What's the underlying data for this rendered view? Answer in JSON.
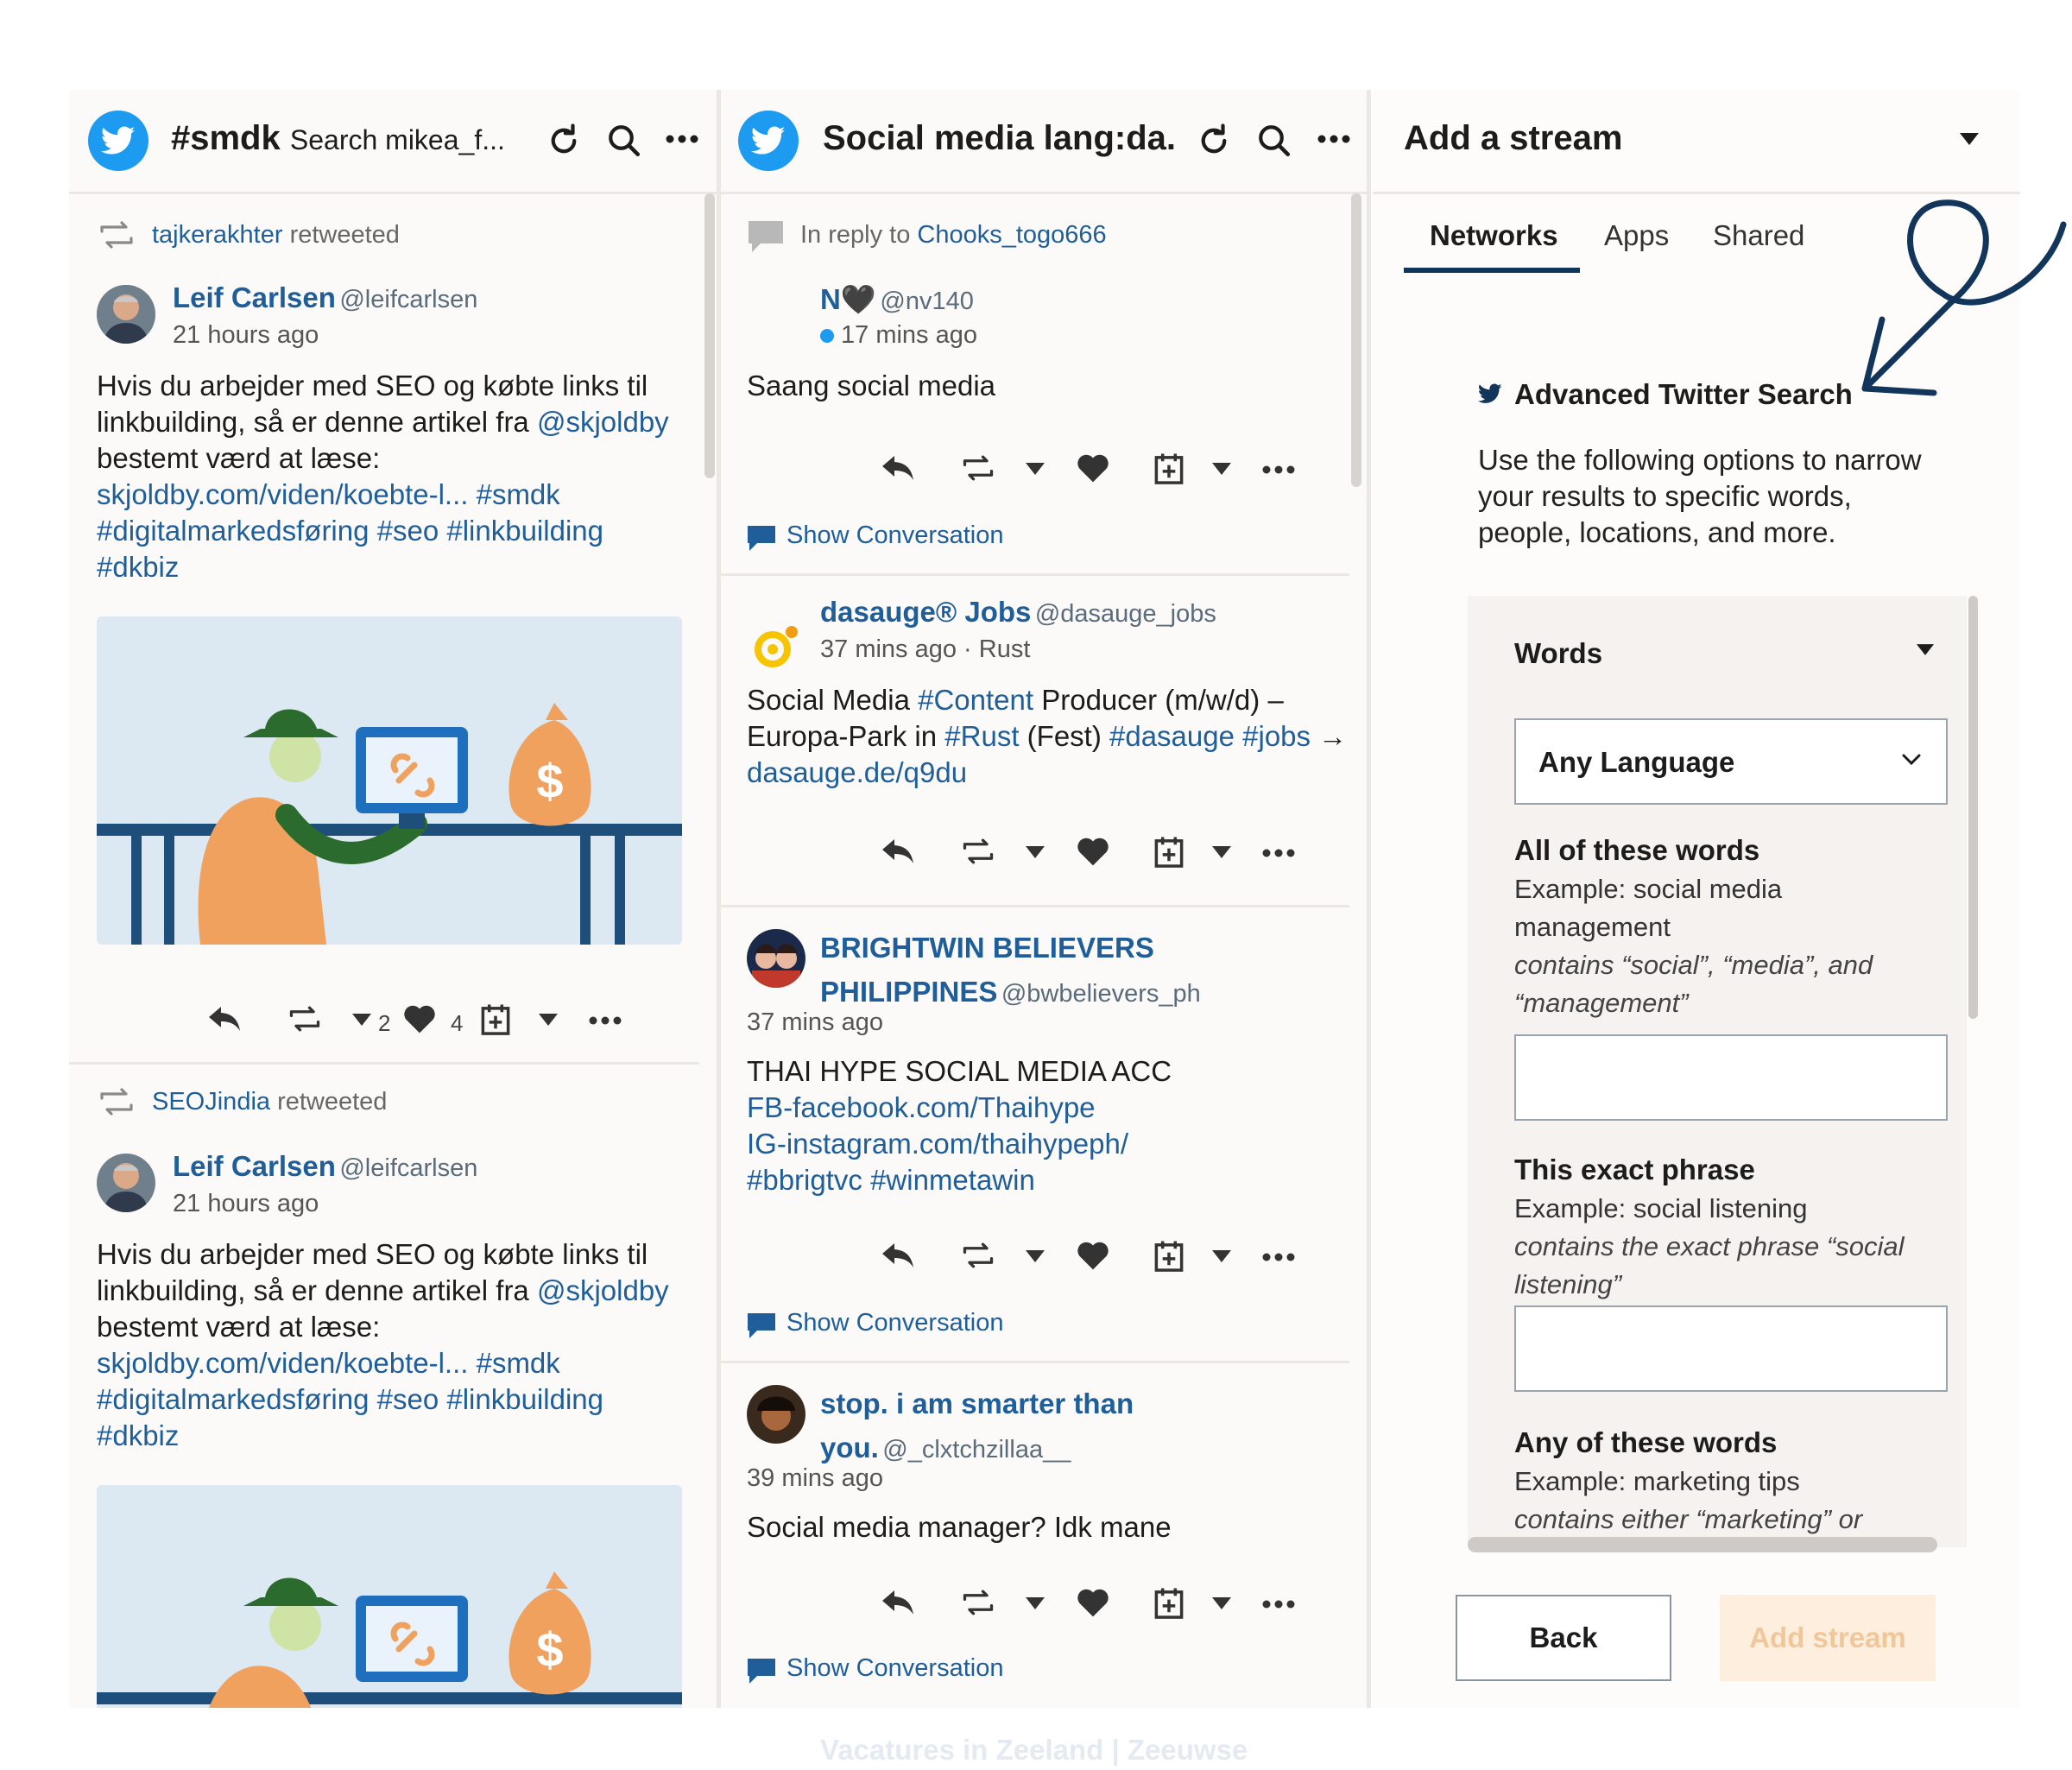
{
  "col1": {
    "title": "#smdk",
    "subtitle": "Search mikea_f...",
    "posts": [
      {
        "retweeted_by": "tajkerakhter",
        "retweeted_word": "retweeted",
        "name": "Leif Carlsen",
        "handle": "@leifcarlsen",
        "time": "21 hours ago",
        "text_plain": "Hvis du arbejder med SEO og købte links til linkbuilding, så er denne artikel fra ",
        "mention": "@skjoldby",
        "text_after": "bestemt værd at læse:",
        "link_line1": "skjoldby.com/viden/koebte-l... #smdk",
        "link_line2": "#digitalmarkedsføring #seo #linkbuilding",
        "link_line3": "#dkbiz",
        "retweet_count": "2",
        "like_count": "4"
      },
      {
        "retweeted_by": "SEOJindia",
        "retweeted_word": "retweeted",
        "name": "Leif Carlsen",
        "handle": "@leifcarlsen",
        "time": "21 hours ago",
        "text_plain": "Hvis du arbejder med SEO og købte links til linkbuilding, så er denne artikel fra ",
        "mention": "@skjoldby",
        "text_after": "bestemt værd at læse:",
        "link_line1": "skjoldby.com/viden/koebte-l... #smdk",
        "link_line2": "#digitalmarkedsføring #seo #linkbuilding",
        "link_line3": "#dkbiz"
      }
    ]
  },
  "col2": {
    "title": "Social media lang:da.",
    "reply_prefix": "In reply to",
    "reply_to": "Chooks_togo666",
    "show_conversation": "Show Conversation",
    "posts": [
      {
        "name": "N🖤",
        "handle": "@nv140",
        "time": "17 mins ago",
        "text": "Saang social media"
      },
      {
        "name": "dasauge® Jobs",
        "handle": "@dasauge_jobs",
        "time": "37 mins ago · Rust",
        "line1_a": "Social Media ",
        "line1_tag": "#Content",
        "line1_b": " Producer (m/w/d) –",
        "line2_a": "Europa-Park in ",
        "line2_tag1": "#Rust",
        "line2_b": " (Fest) ",
        "line2_tag2": "#dasauge #jobs",
        "line2_c": " →",
        "line3": "dasauge.de/q9du"
      },
      {
        "name_line1": "BRIGHTWIN BELIEVERS",
        "name_line2": "PHILIPPINES",
        "handle": "@bwbelievers_ph",
        "time": "37 mins ago",
        "line1": "THAI HYPE SOCIAL MEDIA ACC",
        "line2": "FB-facebook.com/Thaihype",
        "line3": "IG-instagram.com/thaihypeph/",
        "line4": "#bbrigtvc #winmetawin"
      },
      {
        "name_line1": "stop. i am smarter than",
        "name_line2": "you.",
        "handle": "@_clxtchzillaa__",
        "time": "39 mins ago",
        "text": "Social media manager? Idk mane"
      }
    ],
    "faded_next": "Vacatures in Zeeland | Zeeuwse"
  },
  "col3": {
    "title": "Add a stream",
    "tabs": [
      "Networks",
      "Apps",
      "Shared"
    ],
    "section_title": "Advanced Twitter Search",
    "description": [
      "Use the following options to narrow",
      "your results to specific words,",
      "people, locations, and more."
    ],
    "panel": {
      "header": "Words",
      "language": "Any Language",
      "all_words_label": "All of these words",
      "all_words_example": [
        "Example: social media",
        "management"
      ],
      "all_words_hint": [
        "contains “social”, “media”, and",
        "“management”"
      ],
      "exact_label": "This exact phrase",
      "exact_example": "Example: social listening",
      "exact_hint": [
        "contains the exact phrase “social",
        "listening”"
      ],
      "any_label": "Any of these words",
      "any_example": "Example: marketing tips",
      "any_hint": "contains either “marketing” or"
    },
    "back_label": "Back",
    "add_label": "Add stream"
  },
  "colors": {
    "twitter_blue": "#1d9bf0",
    "link_blue": "#1f5e99",
    "tab_underline": "#12355b",
    "add_button_bg": "#fdeedd",
    "add_button_text": "#f1c79a"
  }
}
